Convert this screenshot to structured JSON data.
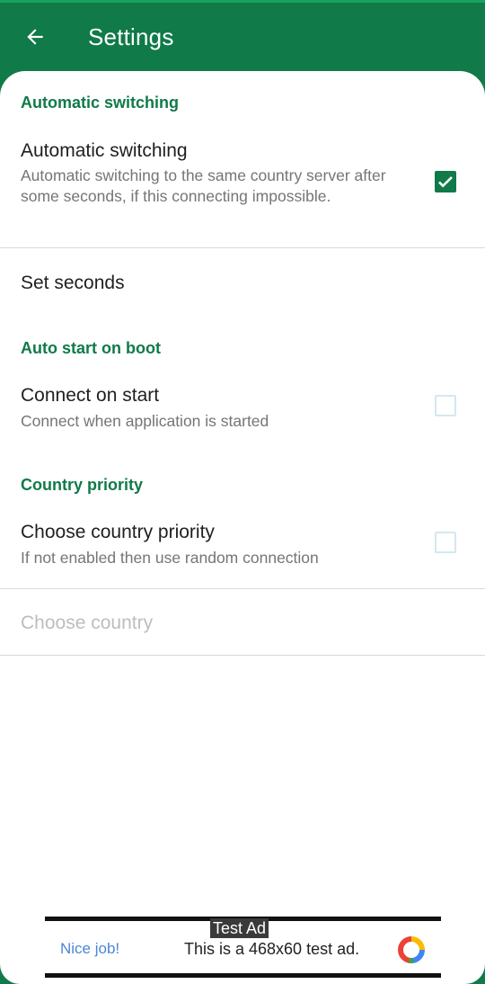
{
  "app_bar": {
    "back_icon": "arrow-left-icon",
    "title": "Settings"
  },
  "sections": {
    "auto_switching": {
      "header": "Automatic switching",
      "pref_title": "Automatic switching",
      "pref_summary": "Automatic switching to the same country server after some seconds, if this connecting impossible.",
      "checked": true
    },
    "set_seconds": {
      "title": "Set seconds"
    },
    "auto_start": {
      "header": "Auto start on boot",
      "pref_title": "Connect on start",
      "pref_summary": "Connect when application is started",
      "checked": false
    },
    "country_priority": {
      "header": "Country priority",
      "pref_title": "Choose country priority",
      "pref_summary": "If not enabled then use random connection",
      "checked": false
    },
    "choose_country": {
      "title": "Choose country",
      "enabled": false
    }
  },
  "ad": {
    "badge": "Test Ad",
    "nice": "Nice job!",
    "text": "This is a 468x60 test ad.",
    "logo_icon": "ad-logo-icon"
  },
  "colors": {
    "primary": "#107a48",
    "checkbox_unchecked_border": "#d4e8f0",
    "disabled_text": "#bdbdbd"
  }
}
